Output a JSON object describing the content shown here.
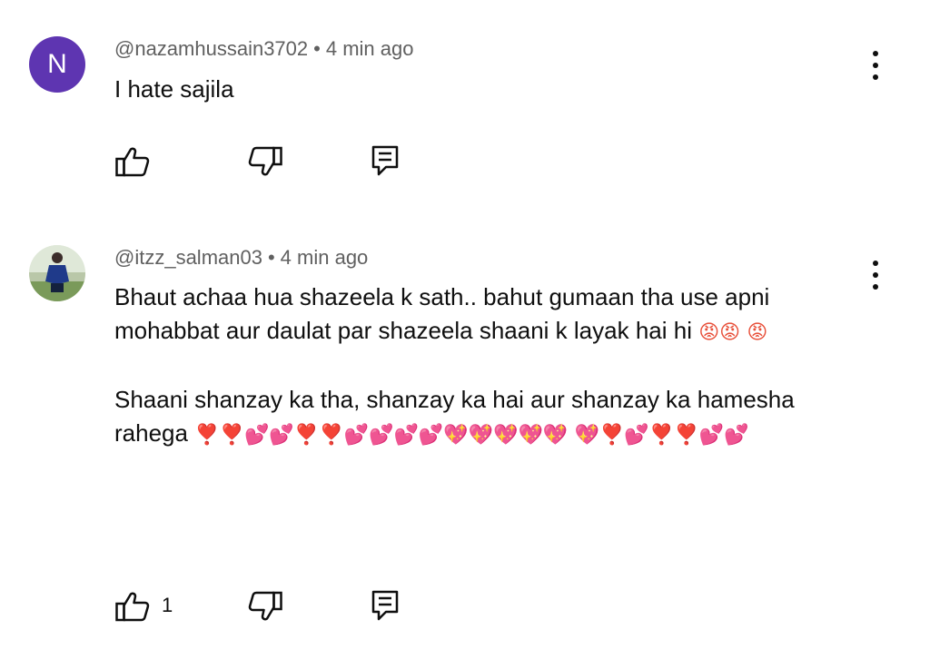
{
  "comments": [
    {
      "avatar_letter": "N",
      "avatar_color": "#5e35b1",
      "author": "@nazamhussain3702",
      "separator": "•",
      "time": "4 min ago",
      "text": "I hate sajila",
      "like_count": ""
    },
    {
      "author": "@itzz_salman03",
      "separator": "•",
      "time": "4 min ago",
      "paragraph1": "Bhaut achaa hua shazeela k sath.. bahut gumaan tha use apni mohabbat aur daulat par shazeela shaani k layak hai hi",
      "paragraph2": "Shaani shanzay ka tha, shanzay ka hai aur shanzay ka hamesha rahega",
      "angry_emoji": "😡",
      "heart_emoji": "❣️",
      "two_hearts_emoji": "💕",
      "sparkling_heart_emoji": "💖",
      "like_count": "1"
    }
  ],
  "icons": {
    "like": "thumb-up-icon",
    "dislike": "thumb-down-icon",
    "reply": "reply-icon",
    "more": "more-vert-icon"
  }
}
